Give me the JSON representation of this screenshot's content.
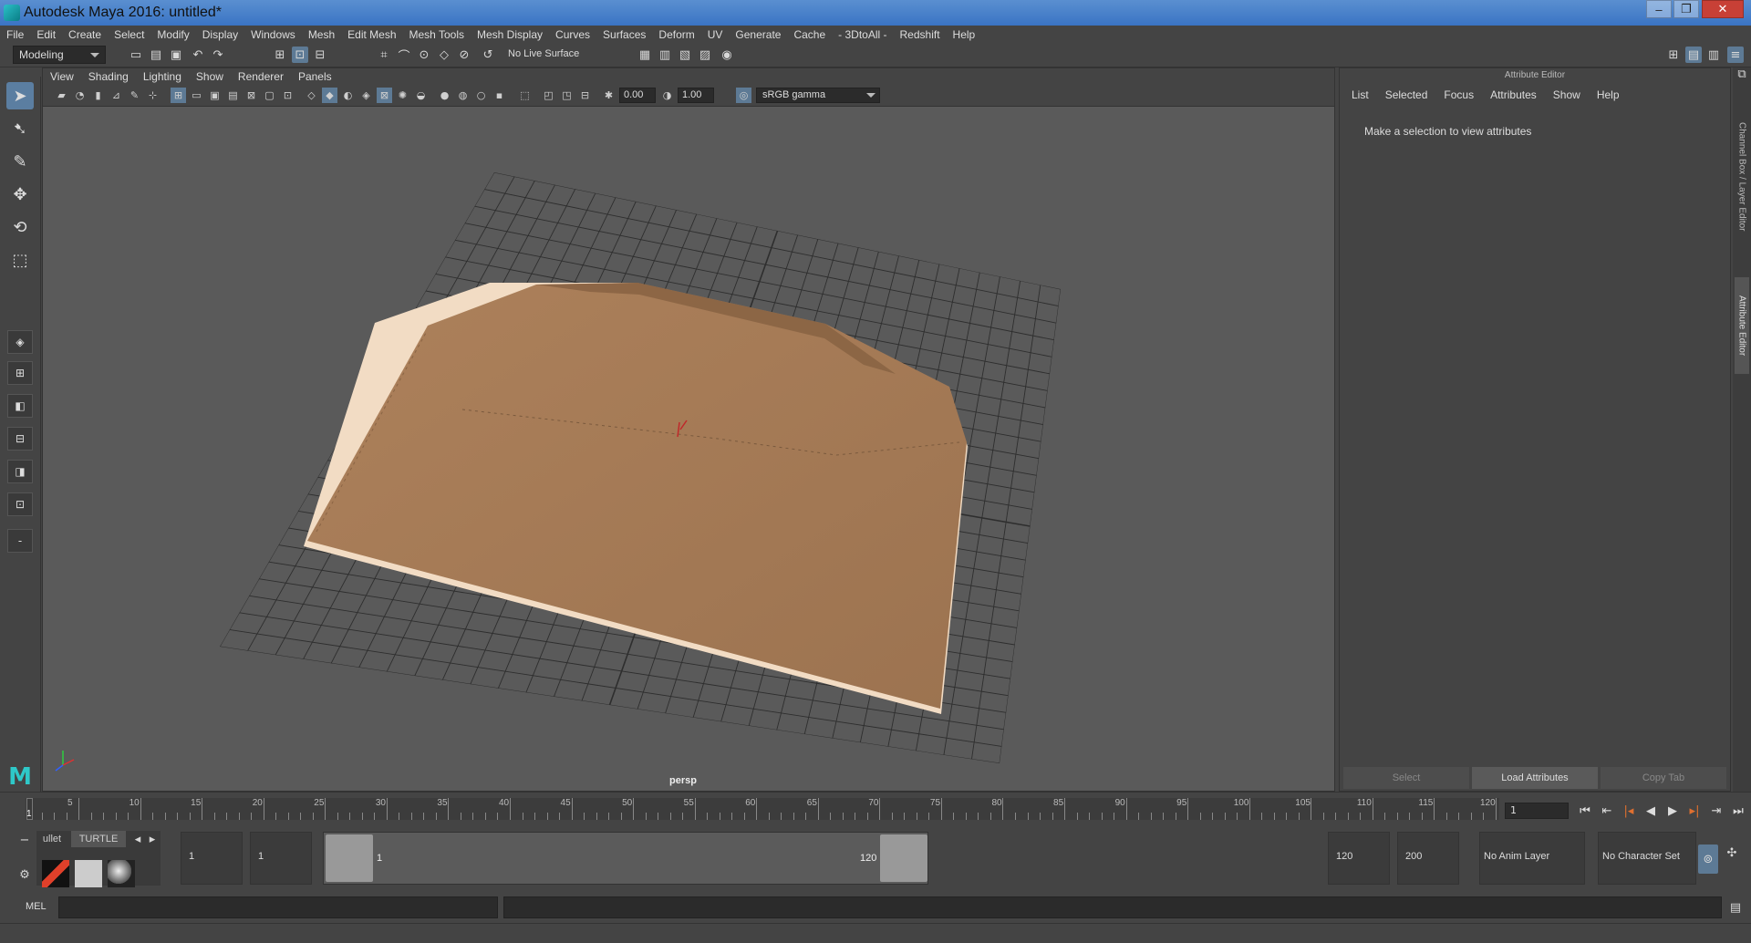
{
  "window": {
    "title": "Autodesk Maya 2016: untitled*",
    "minimize": "–",
    "restore": "❐",
    "close": "✕"
  },
  "menus": [
    "File",
    "Edit",
    "Create",
    "Select",
    "Modify",
    "Display",
    "Windows",
    "Mesh",
    "Edit Mesh",
    "Mesh Tools",
    "Mesh Display",
    "Curves",
    "Surfaces",
    "Deform",
    "UV",
    "Generate",
    "Cache",
    "- 3DtoAll -",
    "Redshift",
    "Help"
  ],
  "status": {
    "mode": "Modeling",
    "live_surface": "No Live Surface"
  },
  "viewport": {
    "menus": [
      "View",
      "Shading",
      "Lighting",
      "Show",
      "Renderer",
      "Panels"
    ],
    "exposure": "0.00",
    "gamma_value": "1.00",
    "color_space": "sRGB gamma",
    "camera_label": "persp",
    "colors": {
      "envelope": "#a57a54",
      "envelope_dark": "#8a6444",
      "grid": "#2e2e2e",
      "bg": "#5a5a5a"
    }
  },
  "attribute_editor": {
    "title": "Attribute Editor",
    "menus": [
      "List",
      "Selected",
      "Focus",
      "Attributes",
      "Show",
      "Help"
    ],
    "message": "Make a selection to view attributes",
    "buttons": {
      "select": "Select",
      "load": "Load Attributes",
      "copy": "Copy Tab"
    }
  },
  "side_tabs": {
    "channel_box": "Channel Box / Layer Editor",
    "attribute_editor": "Attribute Editor"
  },
  "timeline": {
    "start": 1,
    "end": 120,
    "labels": [
      "5",
      "10",
      "15",
      "20",
      "25",
      "30",
      "35",
      "40",
      "45",
      "50",
      "55",
      "60",
      "65",
      "70",
      "75",
      "80",
      "85",
      "90",
      "95",
      "100",
      "105",
      "110",
      "115",
      "120"
    ],
    "current_frame": "1",
    "current_marker": "1"
  },
  "range": {
    "start_min": "1",
    "start": "1",
    "range_start": "1",
    "range_end": "120",
    "end": "120",
    "end_max": "200",
    "anim_layer": "No Anim Layer",
    "character_set": "No Character Set"
  },
  "shelf": {
    "tab1": "ullet",
    "tab2": "TURTLE"
  },
  "command": {
    "language": "MEL"
  }
}
